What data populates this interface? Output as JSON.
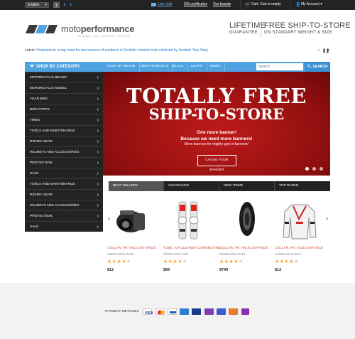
{
  "topbar": {
    "language": "English",
    "currencies": [
      "$",
      "€",
      "£"
    ],
    "live_chat": "Live chat",
    "gift_certificates": "Gift certificates",
    "our_brands": "Our brands",
    "cart": "Cart: Cart is empty",
    "account": "My Account"
  },
  "header": {
    "logo_light": "moto",
    "logo_bold": "performance",
    "tagline": "always two wheels ahead",
    "promo1_big": "LIFETIME",
    "promo1_small": "GUARANTEE",
    "promo2_big": "FREE SHIP-TO-STORE",
    "promo2_small": "ON STANDART WEIGHT & SIZE"
  },
  "latest": {
    "label": "Latest:",
    "text": "Proposals to scrap need for two sources of evidence in Scottish criminal trials criticised by Scottish Tory Party"
  },
  "sidebar": {
    "heading": "SHOP BY CATEGORY",
    "items": [
      "MOTORCYCLE BRAND",
      "MOTORCYCLE MODEL",
      "YEAR BIKE",
      "BIKE PARTS",
      "TIRES",
      "TOOLS AND MAINTENANCE",
      "RIDING GEAR",
      "HELMETS AND ACCESSORIES",
      "PROTECTION",
      "SALE",
      "TOOLS AND MAINTENANCE",
      "RIDING GEAR",
      "HELMETS AND ACCESSORIES",
      "PROTECTION",
      "SALE"
    ]
  },
  "nav": {
    "tabs": [
      "SHOP BY BRAND",
      "NEW PRODUCTS",
      "DEALS",
      "LEARN",
      "NEWS"
    ],
    "search_placeholder": "Search",
    "search_button": "SEARCH"
  },
  "hero": {
    "title1": "TOTALLY FREE",
    "title2": "SHIP-TO-STORE",
    "line1": "One more banner!",
    "line2": "Because we need more banners!",
    "line3": "More banners for mighty god of banners!",
    "button": "CHOSE YOUR BANNER"
  },
  "product_tabs": [
    "BEST SELLERS",
    "CLEARANCE",
    "NEW ITEMS",
    "TOP RATED"
  ],
  "products": [
    {
      "name": "COLLAR, FR. AXLE DISTANCE",
      "sku": "44620-MGS-D10",
      "rating": 4,
      "price": "$12"
    },
    {
      "name": "TUBE, AIR CLEANER CONNECTING",
      "sku": "17253-HR3-A20",
      "rating": 4,
      "price": "$99"
    },
    {
      "name": "COLLAR, FR. AXLE DISTANCE",
      "sku": "44620-MGS-D10",
      "rating": 4,
      "price": "$799"
    },
    {
      "name": "COLLAR, FR. AXLE DISTANCE",
      "sku": "44620-MGS-D10",
      "rating": 4,
      "price": "$12"
    }
  ],
  "footer": {
    "payment_label": "PAYMENT METHODS",
    "payment_icons": [
      "visa-card-icon",
      "mastercard-icon",
      "paypal-icon",
      "amex-icon",
      "visa-electron-icon",
      "maestro-icon",
      "discover-icon",
      "skrill-icon"
    ]
  },
  "colors": {
    "accent": "#4fa3e0",
    "dark": "#232323",
    "hero": "#a51414",
    "price_red": "#d93a2b",
    "star": "#f5a623"
  }
}
